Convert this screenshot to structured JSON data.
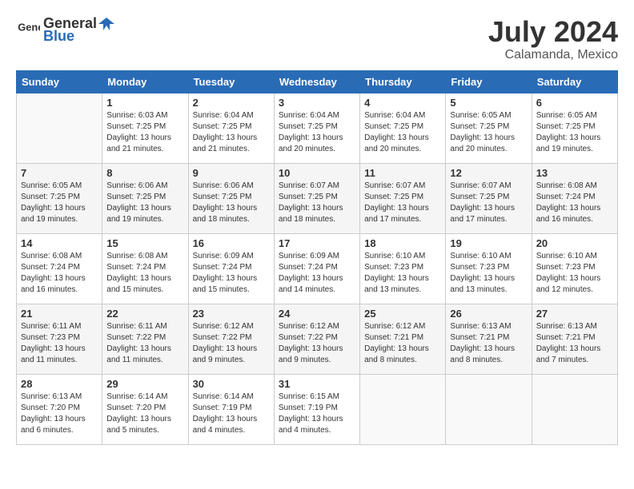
{
  "header": {
    "logo_general": "General",
    "logo_blue": "Blue",
    "month_year": "July 2024",
    "location": "Calamanda, Mexico"
  },
  "calendar": {
    "days_of_week": [
      "Sunday",
      "Monday",
      "Tuesday",
      "Wednesday",
      "Thursday",
      "Friday",
      "Saturday"
    ],
    "weeks": [
      [
        {
          "day": "",
          "sunrise": "",
          "sunset": "",
          "daylight": ""
        },
        {
          "day": "1",
          "sunrise": "Sunrise: 6:03 AM",
          "sunset": "Sunset: 7:25 PM",
          "daylight": "Daylight: 13 hours and 21 minutes."
        },
        {
          "day": "2",
          "sunrise": "Sunrise: 6:04 AM",
          "sunset": "Sunset: 7:25 PM",
          "daylight": "Daylight: 13 hours and 21 minutes."
        },
        {
          "day": "3",
          "sunrise": "Sunrise: 6:04 AM",
          "sunset": "Sunset: 7:25 PM",
          "daylight": "Daylight: 13 hours and 20 minutes."
        },
        {
          "day": "4",
          "sunrise": "Sunrise: 6:04 AM",
          "sunset": "Sunset: 7:25 PM",
          "daylight": "Daylight: 13 hours and 20 minutes."
        },
        {
          "day": "5",
          "sunrise": "Sunrise: 6:05 AM",
          "sunset": "Sunset: 7:25 PM",
          "daylight": "Daylight: 13 hours and 20 minutes."
        },
        {
          "day": "6",
          "sunrise": "Sunrise: 6:05 AM",
          "sunset": "Sunset: 7:25 PM",
          "daylight": "Daylight: 13 hours and 19 minutes."
        }
      ],
      [
        {
          "day": "7",
          "sunrise": "Sunrise: 6:05 AM",
          "sunset": "Sunset: 7:25 PM",
          "daylight": "Daylight: 13 hours and 19 minutes."
        },
        {
          "day": "8",
          "sunrise": "Sunrise: 6:06 AM",
          "sunset": "Sunset: 7:25 PM",
          "daylight": "Daylight: 13 hours and 19 minutes."
        },
        {
          "day": "9",
          "sunrise": "Sunrise: 6:06 AM",
          "sunset": "Sunset: 7:25 PM",
          "daylight": "Daylight: 13 hours and 18 minutes."
        },
        {
          "day": "10",
          "sunrise": "Sunrise: 6:07 AM",
          "sunset": "Sunset: 7:25 PM",
          "daylight": "Daylight: 13 hours and 18 minutes."
        },
        {
          "day": "11",
          "sunrise": "Sunrise: 6:07 AM",
          "sunset": "Sunset: 7:25 PM",
          "daylight": "Daylight: 13 hours and 17 minutes."
        },
        {
          "day": "12",
          "sunrise": "Sunrise: 6:07 AM",
          "sunset": "Sunset: 7:25 PM",
          "daylight": "Daylight: 13 hours and 17 minutes."
        },
        {
          "day": "13",
          "sunrise": "Sunrise: 6:08 AM",
          "sunset": "Sunset: 7:24 PM",
          "daylight": "Daylight: 13 hours and 16 minutes."
        }
      ],
      [
        {
          "day": "14",
          "sunrise": "Sunrise: 6:08 AM",
          "sunset": "Sunset: 7:24 PM",
          "daylight": "Daylight: 13 hours and 16 minutes."
        },
        {
          "day": "15",
          "sunrise": "Sunrise: 6:08 AM",
          "sunset": "Sunset: 7:24 PM",
          "daylight": "Daylight: 13 hours and 15 minutes."
        },
        {
          "day": "16",
          "sunrise": "Sunrise: 6:09 AM",
          "sunset": "Sunset: 7:24 PM",
          "daylight": "Daylight: 13 hours and 15 minutes."
        },
        {
          "day": "17",
          "sunrise": "Sunrise: 6:09 AM",
          "sunset": "Sunset: 7:24 PM",
          "daylight": "Daylight: 13 hours and 14 minutes."
        },
        {
          "day": "18",
          "sunrise": "Sunrise: 6:10 AM",
          "sunset": "Sunset: 7:23 PM",
          "daylight": "Daylight: 13 hours and 13 minutes."
        },
        {
          "day": "19",
          "sunrise": "Sunrise: 6:10 AM",
          "sunset": "Sunset: 7:23 PM",
          "daylight": "Daylight: 13 hours and 13 minutes."
        },
        {
          "day": "20",
          "sunrise": "Sunrise: 6:10 AM",
          "sunset": "Sunset: 7:23 PM",
          "daylight": "Daylight: 13 hours and 12 minutes."
        }
      ],
      [
        {
          "day": "21",
          "sunrise": "Sunrise: 6:11 AM",
          "sunset": "Sunset: 7:23 PM",
          "daylight": "Daylight: 13 hours and 11 minutes."
        },
        {
          "day": "22",
          "sunrise": "Sunrise: 6:11 AM",
          "sunset": "Sunset: 7:22 PM",
          "daylight": "Daylight: 13 hours and 11 minutes."
        },
        {
          "day": "23",
          "sunrise": "Sunrise: 6:12 AM",
          "sunset": "Sunset: 7:22 PM",
          "daylight": "Daylight: 13 hours and 9 minutes."
        },
        {
          "day": "24",
          "sunrise": "Sunrise: 6:12 AM",
          "sunset": "Sunset: 7:22 PM",
          "daylight": "Daylight: 13 hours and 9 minutes."
        },
        {
          "day": "25",
          "sunrise": "Sunrise: 6:12 AM",
          "sunset": "Sunset: 7:21 PM",
          "daylight": "Daylight: 13 hours and 8 minutes."
        },
        {
          "day": "26",
          "sunrise": "Sunrise: 6:13 AM",
          "sunset": "Sunset: 7:21 PM",
          "daylight": "Daylight: 13 hours and 8 minutes."
        },
        {
          "day": "27",
          "sunrise": "Sunrise: 6:13 AM",
          "sunset": "Sunset: 7:21 PM",
          "daylight": "Daylight: 13 hours and 7 minutes."
        }
      ],
      [
        {
          "day": "28",
          "sunrise": "Sunrise: 6:13 AM",
          "sunset": "Sunset: 7:20 PM",
          "daylight": "Daylight: 13 hours and 6 minutes."
        },
        {
          "day": "29",
          "sunrise": "Sunrise: 6:14 AM",
          "sunset": "Sunset: 7:20 PM",
          "daylight": "Daylight: 13 hours and 5 minutes."
        },
        {
          "day": "30",
          "sunrise": "Sunrise: 6:14 AM",
          "sunset": "Sunset: 7:19 PM",
          "daylight": "Daylight: 13 hours and 4 minutes."
        },
        {
          "day": "31",
          "sunrise": "Sunrise: 6:15 AM",
          "sunset": "Sunset: 7:19 PM",
          "daylight": "Daylight: 13 hours and 4 minutes."
        },
        {
          "day": "",
          "sunrise": "",
          "sunset": "",
          "daylight": ""
        },
        {
          "day": "",
          "sunrise": "",
          "sunset": "",
          "daylight": ""
        },
        {
          "day": "",
          "sunrise": "",
          "sunset": "",
          "daylight": ""
        }
      ]
    ]
  }
}
